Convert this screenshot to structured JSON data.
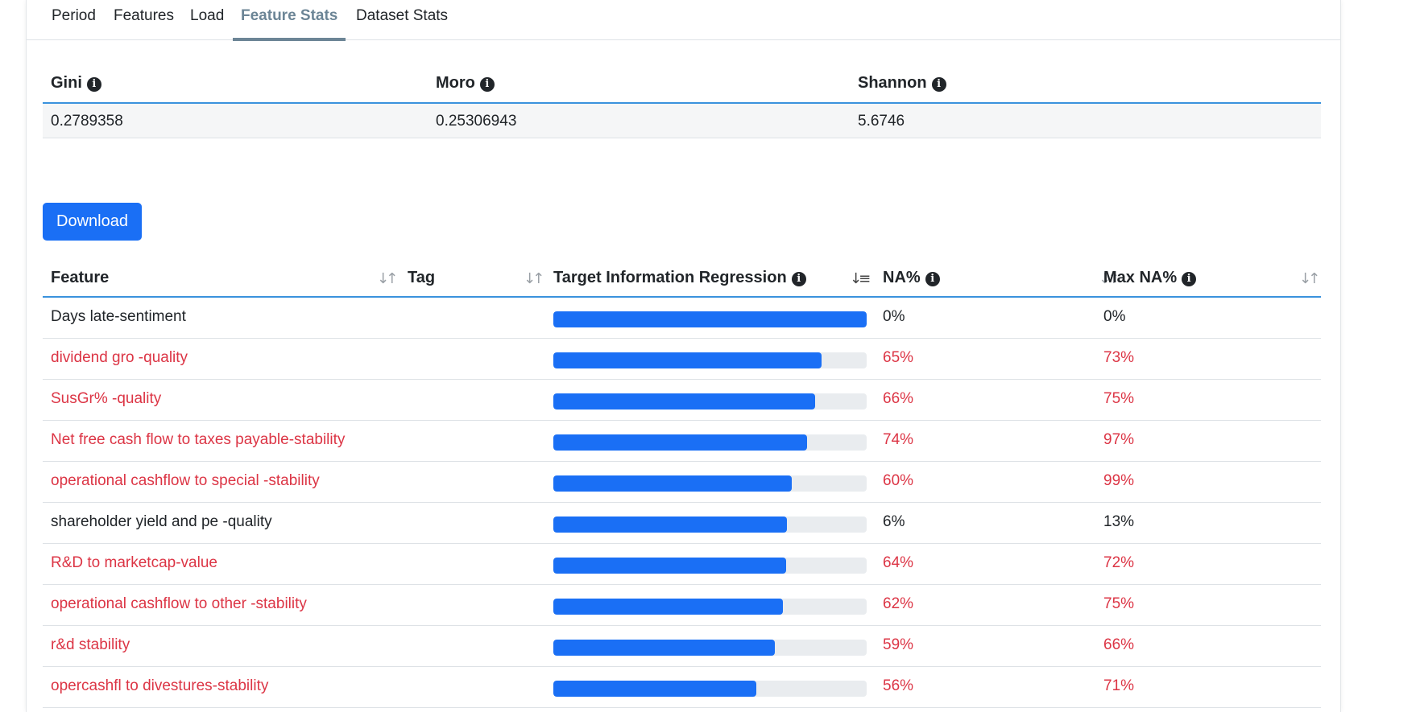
{
  "tabs": [
    {
      "label": "Period",
      "active": false
    },
    {
      "label": "Features",
      "active": false
    },
    {
      "label": "Load",
      "active": false
    },
    {
      "label": "Feature Stats",
      "active": true
    },
    {
      "label": "Dataset Stats",
      "active": false
    }
  ],
  "stats": {
    "headers": [
      "Gini",
      "Moro",
      "Shannon"
    ],
    "values": [
      "0.2789358",
      "0.25306943",
      "5.6746"
    ]
  },
  "download_label": "Download",
  "table": {
    "headers": {
      "feature": "Feature",
      "tag": "Tag",
      "tir": "Target Information Regression",
      "na": "NA%",
      "max_na": "Max NA%"
    },
    "rows": [
      {
        "feature": "Days late-sentiment",
        "tag": "",
        "tir": 1.0,
        "na": "0%",
        "max_na": "0%",
        "warn": false
      },
      {
        "feature": "dividend gro -quality",
        "tag": "",
        "tir": 0.855,
        "na": "65%",
        "max_na": "73%",
        "warn": true
      },
      {
        "feature": "SusGr% -quality",
        "tag": "",
        "tir": 0.835,
        "na": "66%",
        "max_na": "75%",
        "warn": true
      },
      {
        "feature": "Net free cash flow to taxes payable-stability",
        "tag": "",
        "tir": 0.81,
        "na": "74%",
        "max_na": "97%",
        "warn": true
      },
      {
        "feature": "operational cashflow to special -stability",
        "tag": "",
        "tir": 0.76,
        "na": "60%",
        "max_na": "99%",
        "warn": true
      },
      {
        "feature": "shareholder yield and pe -quality",
        "tag": "",
        "tir": 0.745,
        "na": "6%",
        "max_na": "13%",
        "warn": false
      },
      {
        "feature": "R&D to marketcap-value",
        "tag": "",
        "tir": 0.743,
        "na": "64%",
        "max_na": "72%",
        "warn": true
      },
      {
        "feature": "operational cashflow to other -stability",
        "tag": "",
        "tir": 0.733,
        "na": "62%",
        "max_na": "75%",
        "warn": true
      },
      {
        "feature": "r&d stability",
        "tag": "",
        "tir": 0.708,
        "na": "59%",
        "max_na": "66%",
        "warn": true
      },
      {
        "feature": "opercashfl to divestures-stability",
        "tag": "",
        "tir": 0.648,
        "na": "56%",
        "max_na": "71%",
        "warn": true
      }
    ]
  },
  "colors": {
    "accent": "#1a6ff5",
    "warn": "#dc3545",
    "active_tab": "#6c8596",
    "header_rule": "#3a92dd"
  }
}
